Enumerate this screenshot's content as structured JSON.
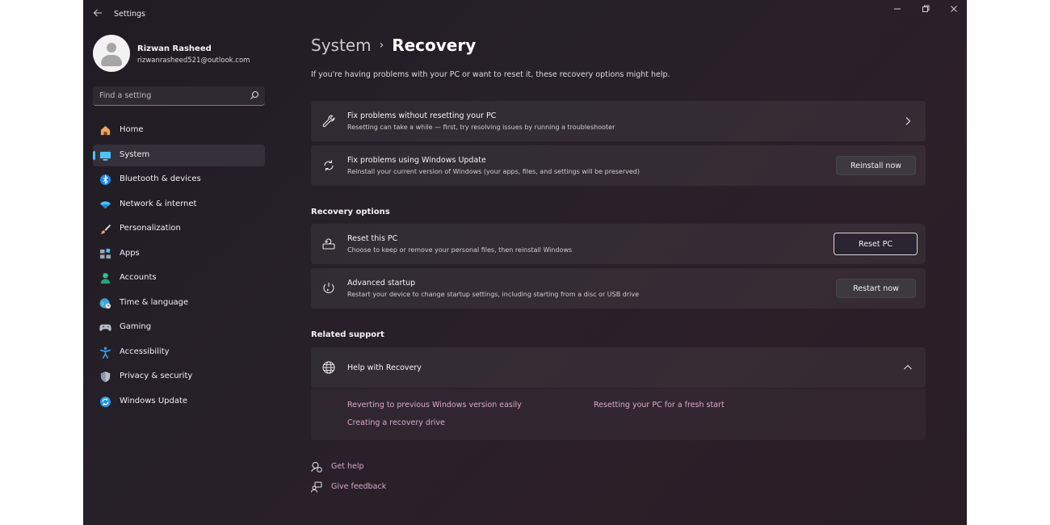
{
  "window": {
    "title": "Settings",
    "back_icon": "arrow-left-icon",
    "controls": [
      "minimize-icon",
      "maximize-icon",
      "close-icon"
    ]
  },
  "profile": {
    "name": "Rizwan Rasheed",
    "email": "rizwanrasheed521@outlook.com"
  },
  "search": {
    "placeholder": "Find a setting"
  },
  "sidebar": {
    "items": [
      {
        "label": "Home",
        "icon": "home-icon"
      },
      {
        "label": "System",
        "icon": "system-icon",
        "active": true
      },
      {
        "label": "Bluetooth & devices",
        "icon": "bluetooth-icon"
      },
      {
        "label": "Network & internet",
        "icon": "wifi-icon"
      },
      {
        "label": "Personalization",
        "icon": "brush-icon"
      },
      {
        "label": "Apps",
        "icon": "apps-icon"
      },
      {
        "label": "Accounts",
        "icon": "accounts-icon"
      },
      {
        "label": "Time & language",
        "icon": "globe-clock-icon"
      },
      {
        "label": "Gaming",
        "icon": "gamepad-icon"
      },
      {
        "label": "Accessibility",
        "icon": "accessibility-icon"
      },
      {
        "label": "Privacy & security",
        "icon": "shield-icon"
      },
      {
        "label": "Windows Update",
        "icon": "update-icon"
      }
    ]
  },
  "breadcrumb": {
    "parent": "System",
    "separator": "›",
    "current": "Recovery"
  },
  "intro": "If you're having problems with your PC or want to reset it, these recovery options might help.",
  "cards": {
    "fix_without_reset": {
      "title": "Fix problems without resetting your PC",
      "desc": "Resetting can take a while — first, try resolving issues by running a troubleshooter"
    },
    "fix_windows_update": {
      "title": "Fix problems using Windows Update",
      "desc": "Reinstall your current version of Windows (your apps, files, and settings will be preserved)",
      "button": "Reinstall now"
    }
  },
  "recovery_options": {
    "heading": "Recovery options",
    "reset": {
      "title": "Reset this PC",
      "desc": "Choose to keep or remove your personal files, then reinstall Windows",
      "button": "Reset PC"
    },
    "advanced": {
      "title": "Advanced startup",
      "desc": "Restart your device to change startup settings, including starting from a disc or USB drive",
      "button": "Restart now"
    }
  },
  "related_support": {
    "heading": "Related support",
    "help_title": "Help with Recovery",
    "links": [
      "Reverting to previous Windows version easily",
      "Resetting your PC for a fresh start",
      "Creating a recovery drive"
    ]
  },
  "footer": {
    "get_help": "Get help",
    "give_feedback": "Give feedback"
  },
  "colors": {
    "accent": "#4cc2ff",
    "link": "#d9a9c9",
    "background": "#272029"
  }
}
